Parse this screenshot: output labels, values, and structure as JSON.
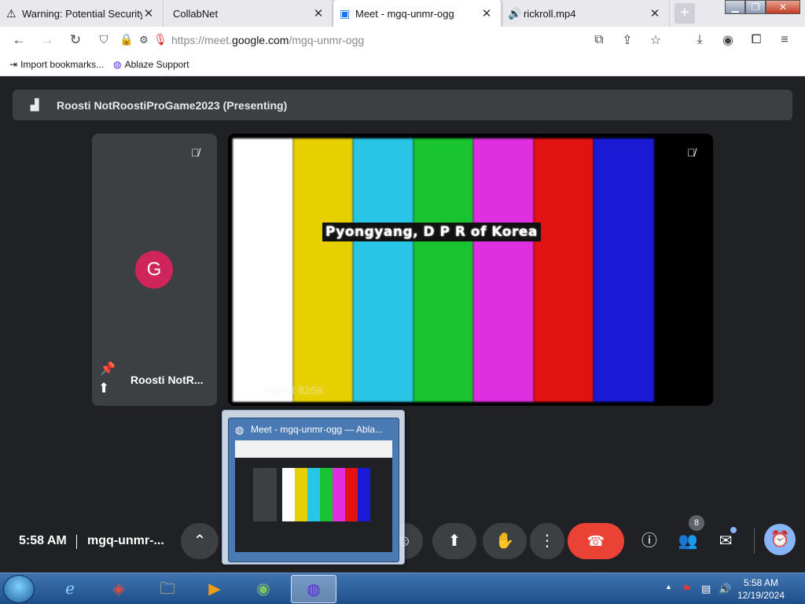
{
  "browser": {
    "tabs": [
      {
        "title": "Warning: Potential Security Ri",
        "icon": "warning-icon"
      },
      {
        "title": "CollabNet",
        "icon": ""
      },
      {
        "title": "Meet - mgq-unmr-ogg",
        "icon": "meet-icon"
      },
      {
        "title": "rickroll.mp4",
        "icon": "speaker-icon"
      }
    ],
    "url_prefix": "https://meet.",
    "url_domain": "google.com",
    "url_path": "/mgq-unmr-ogg",
    "bookmarks": [
      "Import bookmarks...",
      "Ablaze Support"
    ]
  },
  "meet": {
    "presenting_label": "Roosti NotRoostiProGame2023 (Presenting)",
    "avatar_letter": "G",
    "left_tile_name": "Roosti NotR...",
    "right_tile_name": "Guest 826K",
    "video_caption": "Pyongyang, D P R of Korea",
    "color_bars": [
      "#ffffff",
      "#e7d000",
      "#29c5e6",
      "#19c431",
      "#e02fe0",
      "#e21212",
      "#1a1ad4",
      "#000000"
    ],
    "time": "5:58 AM",
    "meeting_code": "mgq-unmr-...",
    "people_count": "8",
    "accent_leave": "#ea4335"
  },
  "taskbar": {
    "preview_title": "Meet - mgq-unmr-ogg — Abla...",
    "time": "5:58 AM",
    "date": "12/19/2024"
  }
}
